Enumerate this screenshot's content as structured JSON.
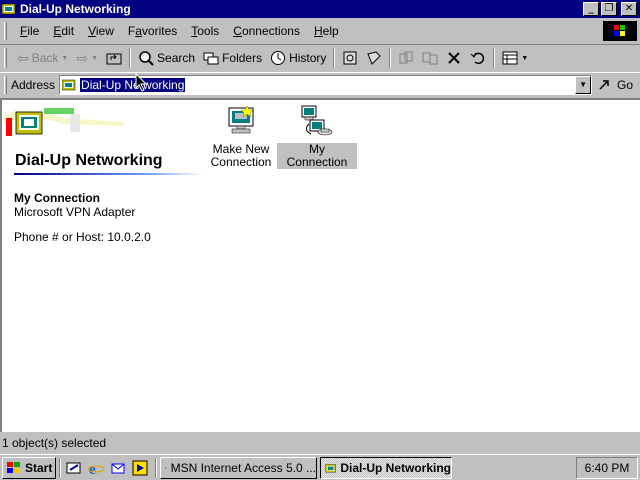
{
  "window": {
    "title": "Dial-Up Networking",
    "controls": [
      "minimize",
      "maximize",
      "close"
    ]
  },
  "menu": [
    {
      "label": "File",
      "key": "F"
    },
    {
      "label": "Edit",
      "key": "E"
    },
    {
      "label": "View",
      "key": "V"
    },
    {
      "label": "Favorites",
      "key": "a"
    },
    {
      "label": "Tools",
      "key": "T"
    },
    {
      "label": "Connections",
      "key": "C"
    },
    {
      "label": "Help",
      "key": "H"
    }
  ],
  "toolbar": {
    "back": "Back",
    "search": "Search",
    "folders": "Folders",
    "history": "History"
  },
  "address": {
    "label": "Address",
    "value": "Dial-Up Networking",
    "go": "Go"
  },
  "folder": {
    "title": "Dial-Up Networking",
    "selected_name": "My Connection",
    "device": "Microsoft VPN Adapter",
    "phone": "Phone # or Host: 10.0.2.0"
  },
  "icons": [
    {
      "name": "make-new-connection",
      "label_line1": "Make New",
      "label_line2": "Connection",
      "icon": "new-connection-icon"
    },
    {
      "name": "my-connection",
      "label": "My Connection",
      "icon": "dialup-connection-icon",
      "selected": true
    }
  ],
  "status": {
    "text": "1 object(s) selected"
  },
  "taskbar": {
    "start": "Start",
    "tasks": [
      {
        "label": "MSN Internet Access 5.0 ...",
        "active": false
      },
      {
        "label": "Dial-Up Networking",
        "active": true
      }
    ],
    "clock": "6:40 PM"
  },
  "colors": {
    "titlebar": "#000080",
    "face": "#c0c0c0",
    "selection": "#000080"
  }
}
